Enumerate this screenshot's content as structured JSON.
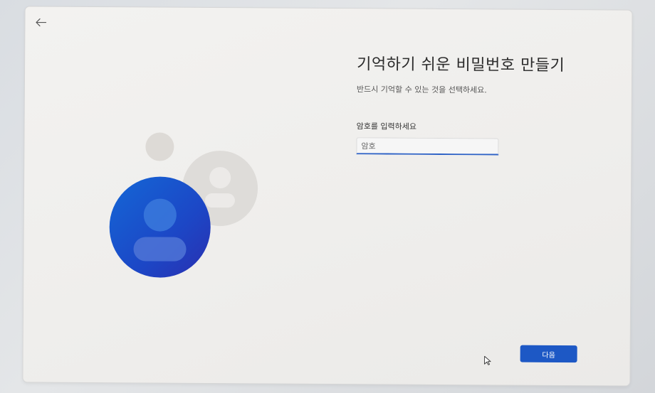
{
  "header": {
    "back_icon": "back-arrow-icon"
  },
  "main": {
    "title": "기억하기 쉬운 비밀번호 만들기",
    "subtitle": "반드시 기억할 수 있는 것을 선택하세요.",
    "password_field": {
      "label": "암호를 입력하세요",
      "placeholder": "암호",
      "value": ""
    }
  },
  "footer": {
    "next_label": "다음"
  },
  "colors": {
    "accent": "#1d58c5",
    "avatar_primary": "#1a50cc",
    "avatar_secondary": "#dcdad7"
  }
}
